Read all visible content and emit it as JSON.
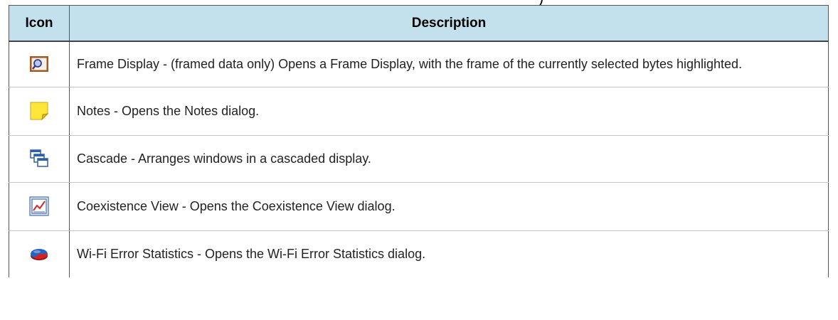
{
  "top_fragment": ")",
  "table": {
    "headers": {
      "icon": "Icon",
      "description": "Description"
    },
    "rows": [
      {
        "icon": "frame-display-icon",
        "description": "Frame Display - (framed data only) Opens a Frame Display, with the frame of the currently selected bytes highlighted."
      },
      {
        "icon": "notes-icon",
        "description": "Notes - Opens the Notes dialog."
      },
      {
        "icon": "cascade-icon",
        "description": "Cascade - Arranges windows in a cascaded display."
      },
      {
        "icon": "coexistence-view-icon",
        "description": "Coexistence View - Opens the Coexistence View dialog."
      },
      {
        "icon": "wifi-error-statistics-icon",
        "description": "Wi-Fi Error Statistics - Opens the Wi-Fi Error Statistics dialog."
      }
    ]
  },
  "colors": {
    "header_bg": "#c2e1ec",
    "border": "#555555",
    "row_divider": "#c6c6c6"
  }
}
